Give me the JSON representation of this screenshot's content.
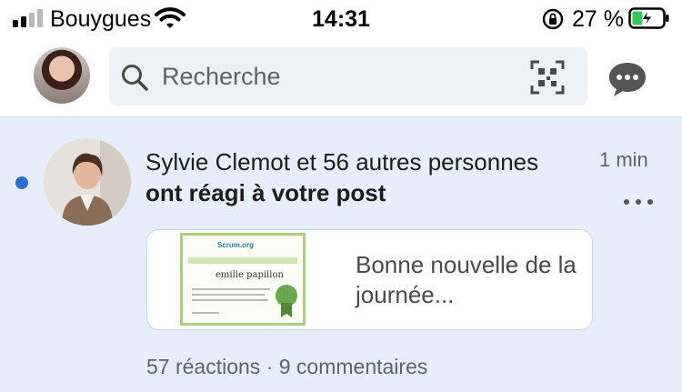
{
  "status_bar": {
    "carrier": "Bouygues",
    "time": "14:31",
    "battery_percent": "27 %"
  },
  "header": {
    "search_placeholder": "Recherche"
  },
  "notification": {
    "title": "Sylvie Clemot et 56 autres personnes",
    "subtitle": "ont réagi à votre post",
    "time": "1 min",
    "post_card": {
      "certificate_heading": "PROFESSIONAL SCRUM PRODUCT OWNER I",
      "certificate_logo": "Scrum.org",
      "certificate_name": "emilie papillon",
      "text": "Bonne nouvelle de la journée..."
    },
    "reactions_summary": "57 réactions · 9 commentaires"
  },
  "icons": {
    "signal": "signal-icon",
    "wifi": "wifi-icon",
    "lock": "orientation-lock-icon",
    "battery": "battery-charging-icon",
    "search": "search-icon",
    "qr": "qr-code-icon",
    "messaging": "messaging-icon",
    "more": "more-options-icon"
  },
  "colors": {
    "accent": "#2a6fcc",
    "notification_background": "#e7eefb",
    "battery_fill": "#34c759"
  }
}
